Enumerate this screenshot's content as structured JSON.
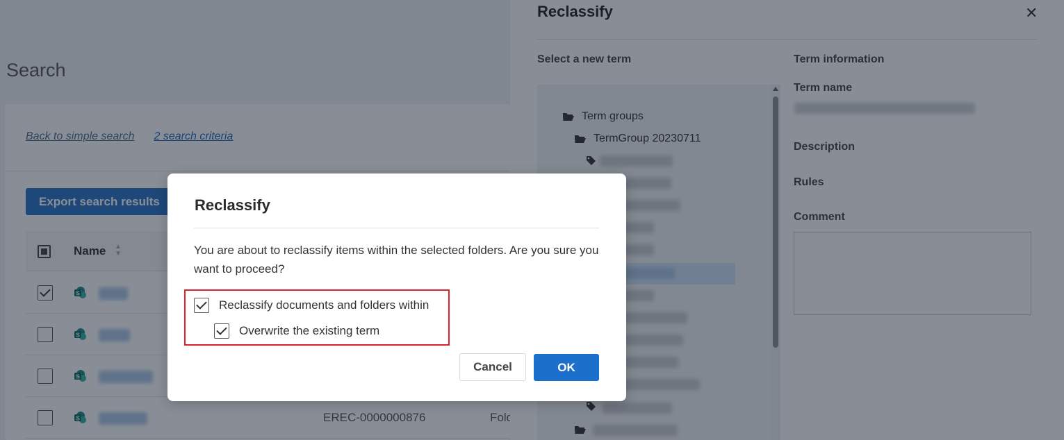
{
  "page": {
    "title": "Search",
    "links": {
      "back": "Back to simple search",
      "criteria": "2 search criteria"
    },
    "export_label": "Export search results",
    "table": {
      "name_header": "Name",
      "rows": [
        {
          "checked": true,
          "id": "",
          "type": ""
        },
        {
          "checked": false,
          "id": "",
          "type": ""
        },
        {
          "checked": false,
          "id": "",
          "type": ""
        },
        {
          "checked": false,
          "id": "EREC-0000000876",
          "type": "Fold"
        }
      ]
    }
  },
  "panel": {
    "title": "Reclassify",
    "close_glyph": "✕",
    "select_label": "Select a new term",
    "info_label": "Term information",
    "term_name_label": "Term name",
    "description_label": "Description",
    "rules_label": "Rules",
    "comment_label": "Comment",
    "tree": {
      "root": "Term groups",
      "group": "TermGroup 20230711"
    }
  },
  "modal": {
    "title": "Reclassify",
    "message": "You are about to reclassify items within the selected folders. Are you sure you want to proceed?",
    "option1": "Reclassify documents and folders within",
    "option2": "Overwrite the existing term",
    "cancel_label": "Cancel",
    "ok_label": "OK"
  },
  "colors": {
    "primary": "#1d6fcc",
    "highlight": "#d9232e"
  }
}
